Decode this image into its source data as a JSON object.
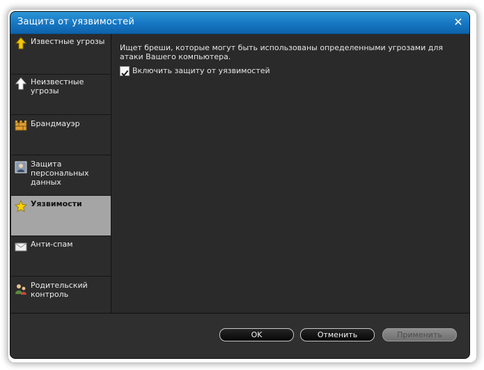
{
  "window": {
    "title": "Защита от уязвимостей",
    "close_label": "✕"
  },
  "sidebar": {
    "items": [
      {
        "label": "Известные угрозы",
        "icon": "arrow-up-yellow-icon",
        "active": false
      },
      {
        "label": "Неизвестные угрозы",
        "icon": "arrow-up-white-icon",
        "active": false
      },
      {
        "label": "Брандмауэр",
        "icon": "firewall-wall-icon",
        "active": false
      },
      {
        "label": "Защита персональных данных",
        "icon": "personal-data-icon",
        "active": false
      },
      {
        "label": "Уязвимости",
        "icon": "star-icon",
        "active": true
      },
      {
        "label": "Анти-спам",
        "icon": "envelope-icon",
        "active": false
      },
      {
        "label": "Родительский контроль",
        "icon": "family-icon",
        "active": false
      }
    ]
  },
  "content": {
    "description": "Ищет бреши, которые могут быть использованы определенными угрозами для атаки Вашего компьютера.",
    "checkbox": {
      "label": "Включить защиту от уязвимостей",
      "checked": true
    }
  },
  "footer": {
    "ok_label": "OK",
    "cancel_label": "Отменить",
    "apply_label": "Применить",
    "apply_enabled": false
  },
  "colors": {
    "titlebar": "#1676c2",
    "background": "#292929",
    "active_item": "#a5a5a5"
  }
}
